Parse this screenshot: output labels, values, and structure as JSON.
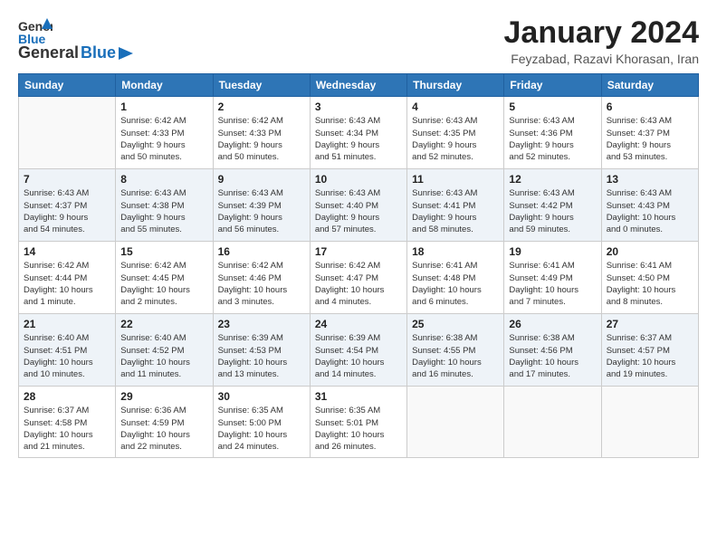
{
  "header": {
    "logo_general": "General",
    "logo_blue": "Blue",
    "title": "January 2024",
    "subtitle": "Feyzabad, Razavi Khorasan, Iran"
  },
  "days_of_week": [
    "Sunday",
    "Monday",
    "Tuesday",
    "Wednesday",
    "Thursday",
    "Friday",
    "Saturday"
  ],
  "weeks": [
    [
      {
        "day": "",
        "info": ""
      },
      {
        "day": "1",
        "info": "Sunrise: 6:42 AM\nSunset: 4:33 PM\nDaylight: 9 hours\nand 50 minutes."
      },
      {
        "day": "2",
        "info": "Sunrise: 6:42 AM\nSunset: 4:33 PM\nDaylight: 9 hours\nand 50 minutes."
      },
      {
        "day": "3",
        "info": "Sunrise: 6:43 AM\nSunset: 4:34 PM\nDaylight: 9 hours\nand 51 minutes."
      },
      {
        "day": "4",
        "info": "Sunrise: 6:43 AM\nSunset: 4:35 PM\nDaylight: 9 hours\nand 52 minutes."
      },
      {
        "day": "5",
        "info": "Sunrise: 6:43 AM\nSunset: 4:36 PM\nDaylight: 9 hours\nand 52 minutes."
      },
      {
        "day": "6",
        "info": "Sunrise: 6:43 AM\nSunset: 4:37 PM\nDaylight: 9 hours\nand 53 minutes."
      }
    ],
    [
      {
        "day": "7",
        "info": "Sunrise: 6:43 AM\nSunset: 4:37 PM\nDaylight: 9 hours\nand 54 minutes."
      },
      {
        "day": "8",
        "info": "Sunrise: 6:43 AM\nSunset: 4:38 PM\nDaylight: 9 hours\nand 55 minutes."
      },
      {
        "day": "9",
        "info": "Sunrise: 6:43 AM\nSunset: 4:39 PM\nDaylight: 9 hours\nand 56 minutes."
      },
      {
        "day": "10",
        "info": "Sunrise: 6:43 AM\nSunset: 4:40 PM\nDaylight: 9 hours\nand 57 minutes."
      },
      {
        "day": "11",
        "info": "Sunrise: 6:43 AM\nSunset: 4:41 PM\nDaylight: 9 hours\nand 58 minutes."
      },
      {
        "day": "12",
        "info": "Sunrise: 6:43 AM\nSunset: 4:42 PM\nDaylight: 9 hours\nand 59 minutes."
      },
      {
        "day": "13",
        "info": "Sunrise: 6:43 AM\nSunset: 4:43 PM\nDaylight: 10 hours\nand 0 minutes."
      }
    ],
    [
      {
        "day": "14",
        "info": "Sunrise: 6:42 AM\nSunset: 4:44 PM\nDaylight: 10 hours\nand 1 minute."
      },
      {
        "day": "15",
        "info": "Sunrise: 6:42 AM\nSunset: 4:45 PM\nDaylight: 10 hours\nand 2 minutes."
      },
      {
        "day": "16",
        "info": "Sunrise: 6:42 AM\nSunset: 4:46 PM\nDaylight: 10 hours\nand 3 minutes."
      },
      {
        "day": "17",
        "info": "Sunrise: 6:42 AM\nSunset: 4:47 PM\nDaylight: 10 hours\nand 4 minutes."
      },
      {
        "day": "18",
        "info": "Sunrise: 6:41 AM\nSunset: 4:48 PM\nDaylight: 10 hours\nand 6 minutes."
      },
      {
        "day": "19",
        "info": "Sunrise: 6:41 AM\nSunset: 4:49 PM\nDaylight: 10 hours\nand 7 minutes."
      },
      {
        "day": "20",
        "info": "Sunrise: 6:41 AM\nSunset: 4:50 PM\nDaylight: 10 hours\nand 8 minutes."
      }
    ],
    [
      {
        "day": "21",
        "info": "Sunrise: 6:40 AM\nSunset: 4:51 PM\nDaylight: 10 hours\nand 10 minutes."
      },
      {
        "day": "22",
        "info": "Sunrise: 6:40 AM\nSunset: 4:52 PM\nDaylight: 10 hours\nand 11 minutes."
      },
      {
        "day": "23",
        "info": "Sunrise: 6:39 AM\nSunset: 4:53 PM\nDaylight: 10 hours\nand 13 minutes."
      },
      {
        "day": "24",
        "info": "Sunrise: 6:39 AM\nSunset: 4:54 PM\nDaylight: 10 hours\nand 14 minutes."
      },
      {
        "day": "25",
        "info": "Sunrise: 6:38 AM\nSunset: 4:55 PM\nDaylight: 10 hours\nand 16 minutes."
      },
      {
        "day": "26",
        "info": "Sunrise: 6:38 AM\nSunset: 4:56 PM\nDaylight: 10 hours\nand 17 minutes."
      },
      {
        "day": "27",
        "info": "Sunrise: 6:37 AM\nSunset: 4:57 PM\nDaylight: 10 hours\nand 19 minutes."
      }
    ],
    [
      {
        "day": "28",
        "info": "Sunrise: 6:37 AM\nSunset: 4:58 PM\nDaylight: 10 hours\nand 21 minutes."
      },
      {
        "day": "29",
        "info": "Sunrise: 6:36 AM\nSunset: 4:59 PM\nDaylight: 10 hours\nand 22 minutes."
      },
      {
        "day": "30",
        "info": "Sunrise: 6:35 AM\nSunset: 5:00 PM\nDaylight: 10 hours\nand 24 minutes."
      },
      {
        "day": "31",
        "info": "Sunrise: 6:35 AM\nSunset: 5:01 PM\nDaylight: 10 hours\nand 26 minutes."
      },
      {
        "day": "",
        "info": ""
      },
      {
        "day": "",
        "info": ""
      },
      {
        "day": "",
        "info": ""
      }
    ]
  ]
}
